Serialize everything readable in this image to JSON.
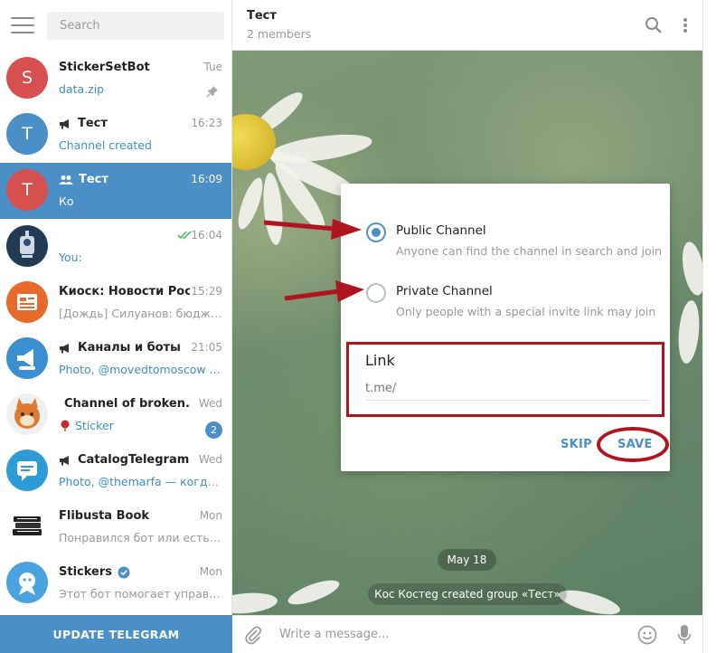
{
  "sidebar": {
    "search_placeholder": "Search",
    "update_button": "UPDATE TELEGRAM",
    "chats": [
      {
        "title": "StickerSetBot",
        "time": "Tue",
        "preview": "data.zip",
        "avatar_letter": "S",
        "avatar_color": "#d6504f",
        "pinned": true
      },
      {
        "title": "Тест",
        "time": "16:23",
        "preview": "Channel created",
        "avatar_letter": "T",
        "avatar_color": "#4a90c7",
        "kind_icon": "megaphone-icon"
      },
      {
        "title": "Тест",
        "time": "16:09",
        "preview": "Ко",
        "avatar_letter": "T",
        "avatar_color": "#d6504f",
        "kind_icon": "group-icon",
        "active": true
      },
      {
        "title": "",
        "time": "16:04",
        "preview": "You:",
        "avatar_color": "#233a55",
        "read_checks": true
      },
      {
        "title": "Киоск: Новости Росс...",
        "time": "15:29",
        "preview": "[Дождь] Силуанов: бюджет...",
        "avatar_color": "#e8692c"
      },
      {
        "title": "Каналы и боты",
        "time": "21:05",
        "preview": "Photo, @movedtomoscow ...",
        "avatar_color": "#3b8fd0",
        "kind_icon": "megaphone-icon"
      },
      {
        "title": "Channel of broken...",
        "time": "Wed",
        "preview": "Sticker",
        "avatar_color": "#f0f0f0",
        "kind_icon": "megaphone-icon",
        "unread": "2"
      },
      {
        "title": "CatalogTelegram",
        "time": "Wed",
        "preview": "Photo, @themarfa — когда ...",
        "avatar_color": "#2d9bd6",
        "kind_icon": "megaphone-icon"
      },
      {
        "title": "Flibusta Book",
        "time": "Mon",
        "preview": "Понравился бот или есть п...",
        "avatar_color": "#ffffff"
      },
      {
        "title": "Stickers",
        "time": "Mon",
        "preview": "Этот бот помогает управля...",
        "avatar_color": "#4aa3df",
        "verified": true
      }
    ]
  },
  "header": {
    "title": "Тест",
    "subtitle": "2 members"
  },
  "chat": {
    "date_chip": "May 18",
    "service_message": "Кос Костеg created group «Тест»"
  },
  "composer": {
    "placeholder": "Write a message..."
  },
  "dialog": {
    "public": {
      "label": "Public Channel",
      "desc": "Anyone can find the channel in search and join",
      "selected": true
    },
    "private": {
      "label": "Private Channel",
      "desc": "Only people with a special invite link may join",
      "selected": false
    },
    "link_label": "Link",
    "link_placeholder": "t.me/",
    "skip": "SKIP",
    "save": "SAVE"
  },
  "colors": {
    "accent": "#4a90c7",
    "annotation_red": "#b0141e"
  }
}
